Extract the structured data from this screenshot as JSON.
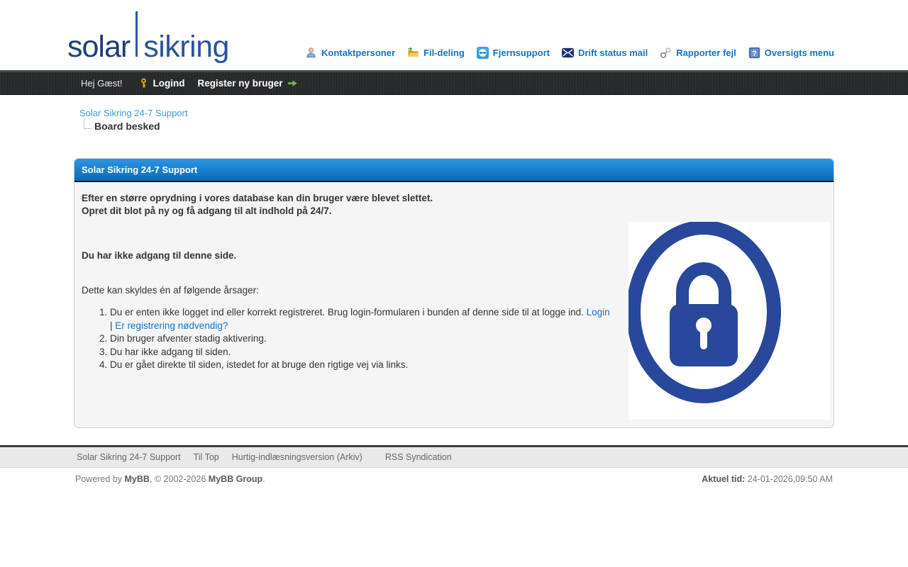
{
  "logo": {
    "part1": "solar",
    "part2": "sikring"
  },
  "nav": {
    "items": [
      {
        "label": "Kontaktpersoner",
        "icon": "person-icon"
      },
      {
        "label": "Fil-deling",
        "icon": "folder-share-icon"
      },
      {
        "label": "Fjernsupport",
        "icon": "remote-support-icon"
      },
      {
        "label": "Drift status mail",
        "icon": "mail-icon"
      },
      {
        "label": "Rapporter fejl",
        "icon": "keys-icon"
      },
      {
        "label": "Oversigts menu",
        "icon": "help-book-icon"
      }
    ]
  },
  "userbar": {
    "greeting": "Hej Gæst!",
    "login_label": "Logind",
    "register_label": "Register ny bruger",
    "key_icon": "key-icon",
    "arrow_icon": "green-arrow-icon"
  },
  "breadcrumb": {
    "root": "Solar Sikring 24-7 Support",
    "current": "Board besked"
  },
  "board_message": {
    "title": "Solar Sikring 24-7 Support",
    "intro_line1": "Efter en større oprydning i vores database kan din bruger være blevet slettet.",
    "intro_line2": "Opret dit blot på ny og få adgang til alt indhold på 24/7.",
    "no_access": "Du har ikke adgang til denne side.",
    "reasons_heading": "Dette kan skyldes én af følgende årsager:",
    "reasons": {
      "item1_text": "Du er enten ikke logget ind eller korrekt registreret. Brug login-formularen i bunden af denne side til at logge ind. ",
      "item1_link1": "Login",
      "item1_separator": " | ",
      "item1_link2": "Er registrering nødvendig?",
      "item2": "Din bruger afventer stadig aktivering.",
      "item3": "Du har ikke adgang til siden.",
      "item4": "Du er gået direkte til siden, istedet for at bruge den rigtige vej via links."
    },
    "lock_image": "padlock-in-oval"
  },
  "footer": {
    "links": [
      "Solar Sikring 24-7 Support",
      "Til Top",
      "Hurtig-indlæsningsversion (Arkiv)",
      "RSS Syndication"
    ],
    "powered_prefix": "Powered by ",
    "powered_link1": "MyBB",
    "powered_middle": ", © 2002-2026 ",
    "powered_link2": "MyBB Group",
    "powered_suffix": ".",
    "time_label": "Aktuel tid:",
    "time_value": " 24-01-2026,09:50 AM"
  },
  "colors": {
    "link_blue": "#1373c4",
    "breadcrumb_link_blue": "#3c98d9",
    "title_bar_gradient_top": "#2a96e4",
    "title_bar_gradient_bottom": "#0d6ab6",
    "lock_blue": "#27489b",
    "logo_blue": "#1d3e7c",
    "userbar_dark": "#28292b",
    "key_gold": "#e9b515",
    "arrow_green": "#74b54a"
  }
}
